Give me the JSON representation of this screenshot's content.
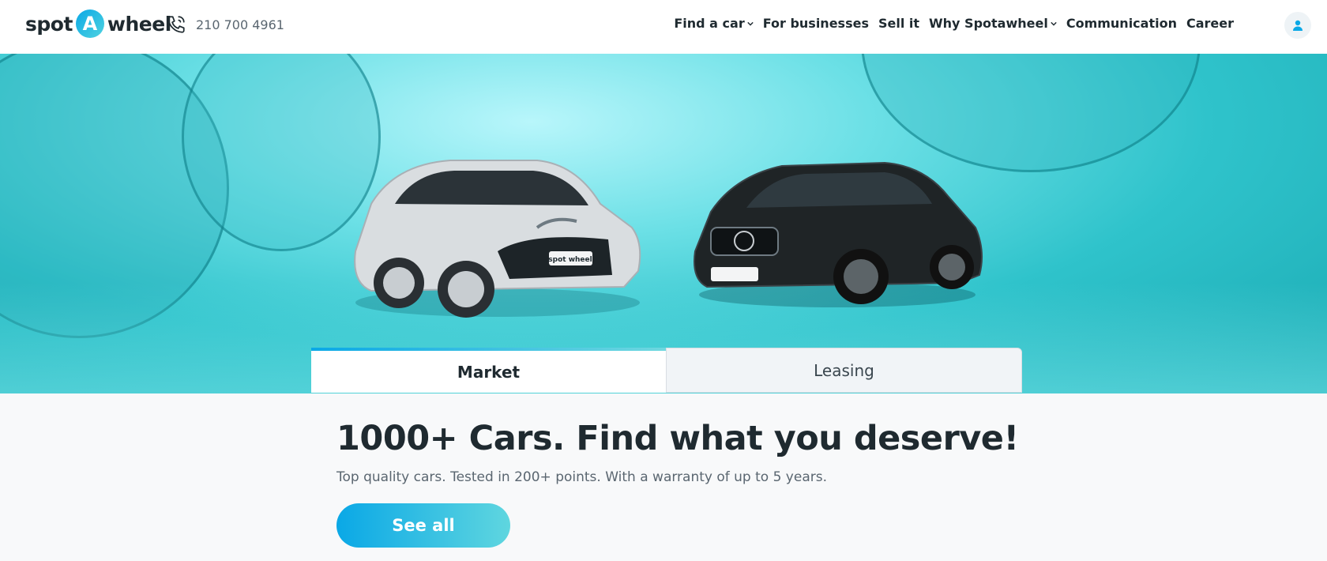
{
  "brand": {
    "word_left": "spot",
    "badge": "A",
    "word_right": "wheel",
    "accent": "#0aa8e6",
    "accent_end": "#5fd6df"
  },
  "header": {
    "phone": "210 700 4961",
    "nav": [
      {
        "label": "Find a car",
        "dropdown": true
      },
      {
        "label": "For businesses",
        "dropdown": false
      },
      {
        "label": "Sell it",
        "dropdown": false
      },
      {
        "label": "Why Spotawheel",
        "dropdown": true
      },
      {
        "label": "Communication",
        "dropdown": false
      },
      {
        "label": "Career",
        "dropdown": false
      }
    ],
    "icons": {
      "phone": "phone-icon",
      "user": "user-icon",
      "chevron": "chevron-down-icon"
    }
  },
  "hero": {
    "plate_text": "spot wheel"
  },
  "tabs": [
    {
      "label": "Market",
      "active": true
    },
    {
      "label": "Leasing",
      "active": false
    }
  ],
  "main": {
    "headline": "1000+ Cars. Find what you deserve!",
    "subline": "Top quality cars. Tested in 200+ points. With a warranty of up to 5 years.",
    "cta_label": "See all"
  }
}
